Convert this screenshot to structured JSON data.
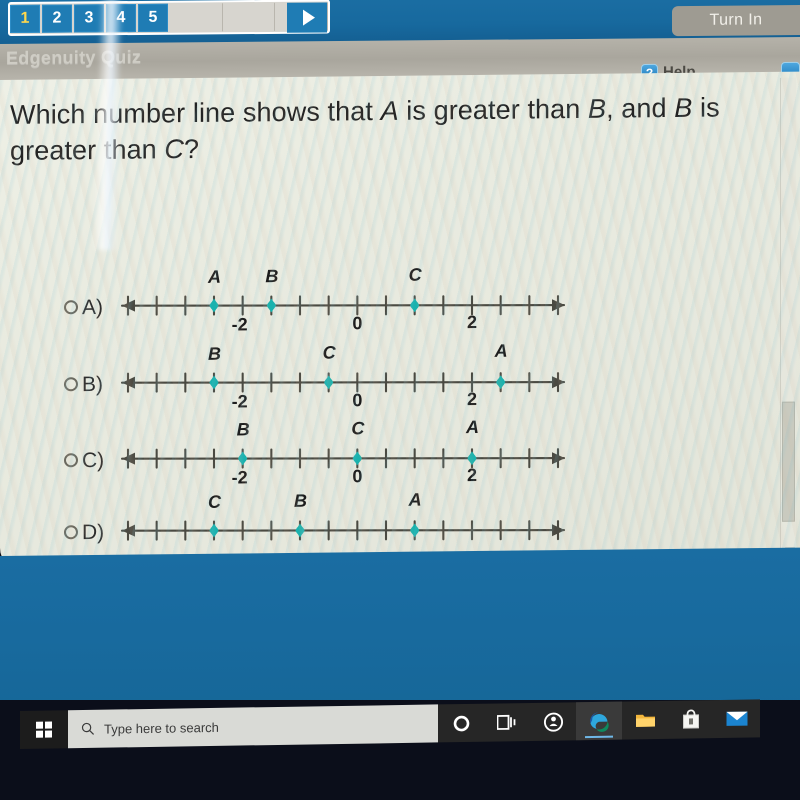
{
  "window": {
    "app_title": "Edgenuity Quiz",
    "turn_in_label": "Turn In",
    "help_label": "Help",
    "help_icon_glyph": "?",
    "question_numbers": [
      "1",
      "2",
      "3",
      "4",
      "5"
    ],
    "active_question": "1",
    "play_icon": "play-triangle",
    "accent_blue": "#1a6da2",
    "toolbar_grey": "#aeaba2",
    "sheet_cream": "#e9ebe0",
    "point_color": "#19b2ae"
  },
  "question": {
    "line1_a": "Which number line shows that ",
    "line1_ital1": "A",
    "line1_b": " is greater than ",
    "line1_ital2": "B",
    "line1_c": ", and ",
    "line1_ital3": "B",
    "line1_d": " is",
    "line2_a": "greater than ",
    "line2_ital1": "C",
    "line2_b": "?",
    "full_text": "Which number line shows that A is greater than B, and B is greater than C?"
  },
  "options": [
    {
      "id": "A",
      "letter": "A)",
      "selected": false,
      "axis_ticks": [
        "-2",
        "0",
        "2"
      ],
      "points": [
        {
          "label": "A",
          "value": -2.5
        },
        {
          "label": "B",
          "value": -1.5
        },
        {
          "label": "C",
          "value": 1.0
        }
      ]
    },
    {
      "id": "B",
      "letter": "B)",
      "selected": false,
      "axis_ticks": [
        "-2",
        "0",
        "2"
      ],
      "points": [
        {
          "label": "B",
          "value": -2.5
        },
        {
          "label": "C",
          "value": -0.5
        },
        {
          "label": "A",
          "value": 2.5
        }
      ]
    },
    {
      "id": "C",
      "letter": "C)",
      "selected": false,
      "axis_ticks": [
        "-2",
        "0",
        "2"
      ],
      "points": [
        {
          "label": "B",
          "value": -2.0
        },
        {
          "label": "C",
          "value": 0.0
        },
        {
          "label": "A",
          "value": 2.0
        }
      ]
    },
    {
      "id": "D",
      "letter": "D)",
      "selected": false,
      "axis_ticks": [],
      "points": [
        {
          "label": "C",
          "value": -2.5
        },
        {
          "label": "B",
          "value": -1.0
        },
        {
          "label": "A",
          "value": 1.0
        }
      ]
    }
  ],
  "number_line": {
    "min": -4.0,
    "max": 3.5,
    "step": 0.5,
    "arrow_left": "left-arrow",
    "arrow_right": "right-arrow"
  },
  "scrollbar": {
    "down_arrow_icon": "chevron-down-icon"
  },
  "taskbar": {
    "start_icon": "windows-logo-icon",
    "search_icon": "search-icon",
    "search_placeholder": "Type here to search",
    "items": [
      {
        "name": "cortana-icon",
        "glyph": "O"
      },
      {
        "name": "task-view-icon",
        "glyph": "⌸"
      },
      {
        "name": "app-circle-icon",
        "glyph": "◎"
      },
      {
        "name": "edge-browser-icon",
        "glyph": "e"
      },
      {
        "name": "file-explorer-icon",
        "glyph": "▤"
      },
      {
        "name": "microsoft-store-icon",
        "glyph": "Ὤd"
      },
      {
        "name": "mail-icon",
        "glyph": "✉"
      }
    ]
  }
}
